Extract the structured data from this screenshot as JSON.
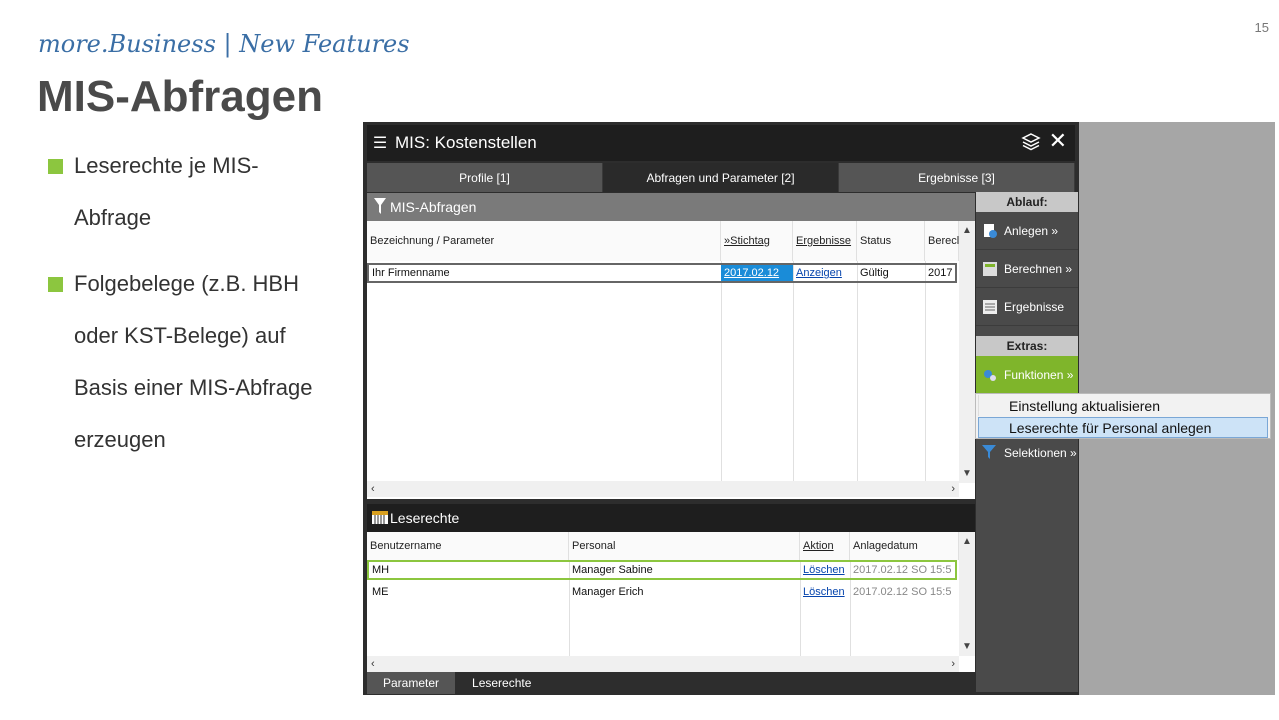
{
  "slide": {
    "brand": "more.Business | New Features",
    "title": "MIS-Abfragen",
    "page_number": "15",
    "bullets": [
      "Leserechte je MIS-Abfrage",
      "Folgebelege (z.B. HBH oder KST-Belege) auf Basis einer MIS-Abfrage erzeugen"
    ],
    "bullet_color": "#8cc63f"
  },
  "window": {
    "title": "MIS: Kostenstellen",
    "menu_icon": "list-icon",
    "layers_icon": "layers-icon",
    "close_icon": "close-icon",
    "tabs": [
      "Profile [1]",
      "Abfragen und Parameter [2]",
      "Ergebnisse [3]"
    ],
    "active_tab": 1
  },
  "queries": {
    "section_title": "MIS-Abfragen",
    "columns": [
      "Bezeichnung / Parameter",
      "»Stichtag",
      "Ergebnisse",
      "Status",
      "Berecl"
    ],
    "rows": [
      {
        "name": "Ihr Firmenname",
        "date": "2017.02.12",
        "results": "Anzeigen",
        "status": "Gültig",
        "calc": "2017"
      }
    ]
  },
  "permissions": {
    "section_title": "Leserechte",
    "columns": [
      "Benutzername",
      "Personal",
      "Aktion",
      "Anlagedatum"
    ],
    "rows": [
      {
        "user": "MH",
        "person": "Manager  Sabine",
        "action": "Löschen",
        "date": "2017.02.12 SO 15:5"
      },
      {
        "user": "ME",
        "person": "Manager Erich",
        "action": "Löschen",
        "date": "2017.02.12 SO 15:5"
      }
    ]
  },
  "sidebar": {
    "flow_header": "Ablauf:",
    "flow_buttons": [
      "Anlegen »",
      "Berechnen »",
      "Ergebnisse"
    ],
    "extras_header": "Extras:",
    "functions_button": "Funktionen »",
    "selections_button": "Selektionen »",
    "accent_color": "#7fb52b"
  },
  "dropdown": {
    "items": [
      "Einstellung aktualisieren",
      "Leserechte für Personal anlegen"
    ],
    "highlighted": 1
  },
  "bottom_tabs": [
    "Parameter",
    "Leserechte"
  ]
}
